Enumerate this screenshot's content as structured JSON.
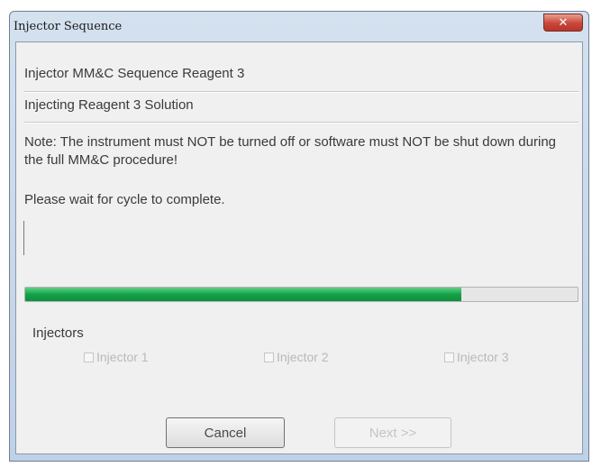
{
  "window": {
    "title": "Injector Sequence",
    "close_glyph": "✕"
  },
  "header": {
    "sequence_title": "Injector MM&C Sequence Reagent 3",
    "status": "Injecting Reagent 3 Solution"
  },
  "messages": {
    "note": "Note: The instrument must NOT be turned off or software must NOT be shut down during the full MM&C procedure!",
    "wait": "Please wait for cycle to complete."
  },
  "progress": {
    "fraction": 0.79,
    "fill_color": "#14a148"
  },
  "injectors": {
    "label": "Injectors",
    "items": [
      {
        "label": "Injector 1",
        "checked": false,
        "enabled": false
      },
      {
        "label": "Injector 2",
        "checked": false,
        "enabled": false
      },
      {
        "label": "Injector 3",
        "checked": false,
        "enabled": false
      }
    ]
  },
  "buttons": {
    "cancel": "Cancel",
    "next": "Next >>"
  }
}
